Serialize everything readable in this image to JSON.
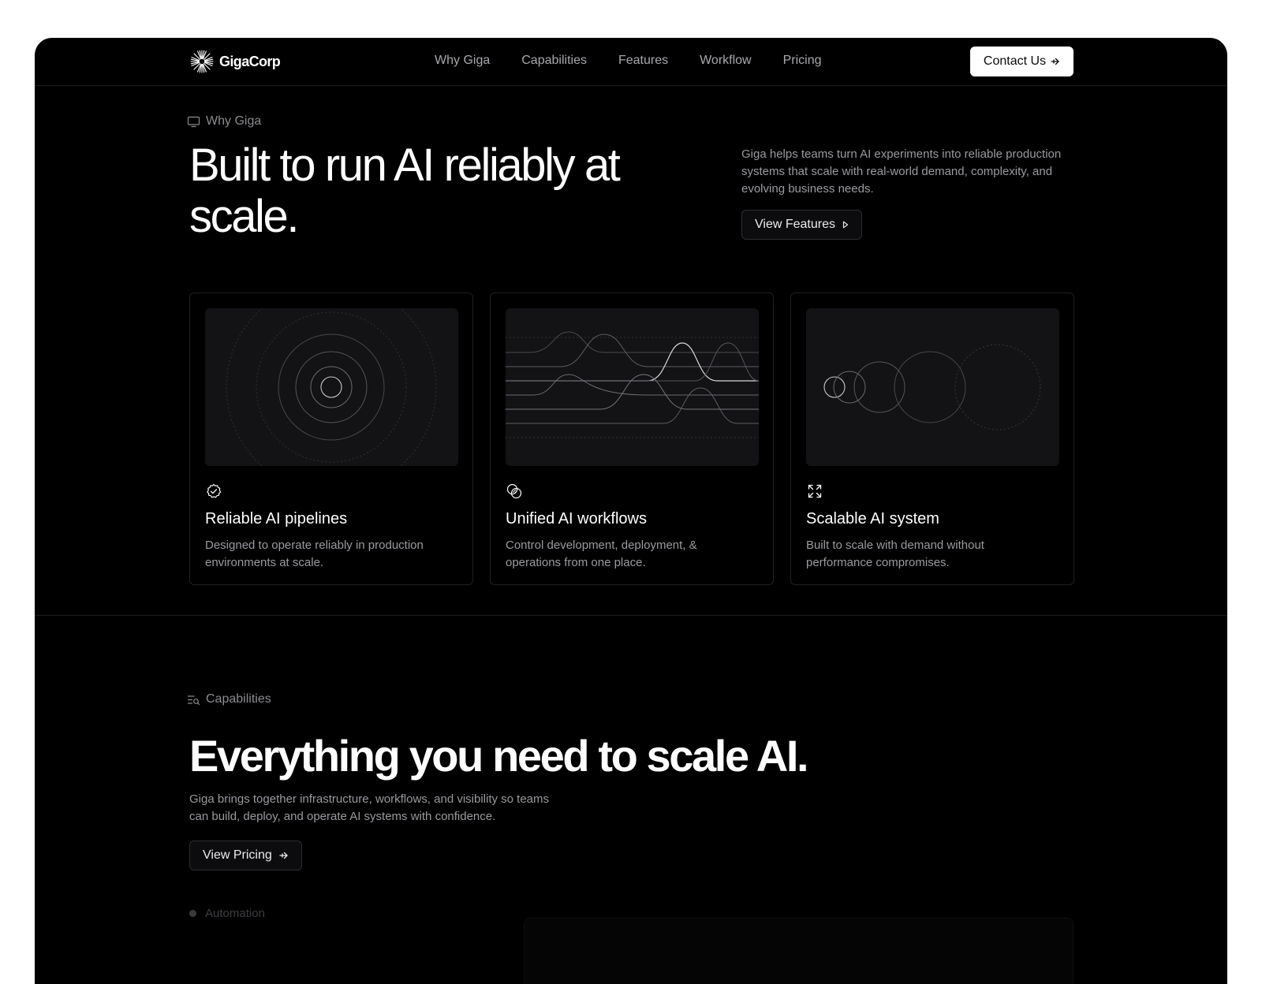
{
  "brand": {
    "name": "GigaCorp"
  },
  "nav": {
    "links": [
      "Why Giga",
      "Capabilities",
      "Features",
      "Workflow",
      "Pricing"
    ],
    "cta": "Contact Us"
  },
  "hero": {
    "eyebrow": "Why Giga",
    "title": "Built to run AI reliably at scale.",
    "description": "Giga helps teams turn AI experiments into reliable production systems that scale with real-world demand, complexity, and evolving business needs.",
    "button": "View Features"
  },
  "cards": [
    {
      "icon": "badge-check-icon",
      "title": "Reliable AI pipelines",
      "description": "Designed to operate reliably in production environments at scale."
    },
    {
      "icon": "overlap-circles-icon",
      "title": "Unified AI workflows",
      "description": "Control development, deployment, & operations from one place."
    },
    {
      "icon": "expand-icon",
      "title": "Scalable AI system",
      "description": "Built to scale with demand without performance compromises."
    }
  ],
  "capabilities": {
    "eyebrow": "Capabilities",
    "title": "Everything you need to scale AI.",
    "description": "Giga brings together infrastructure, workflows, and visibility so teams can build, deploy, and operate AI systems with confidence.",
    "button": "View Pricing",
    "list": [
      "Automation"
    ]
  },
  "colors": {
    "background": "#000000",
    "page": "#ffffff",
    "card": "#131316",
    "text": "#ffffff",
    "muted": "#9a9aa0"
  }
}
